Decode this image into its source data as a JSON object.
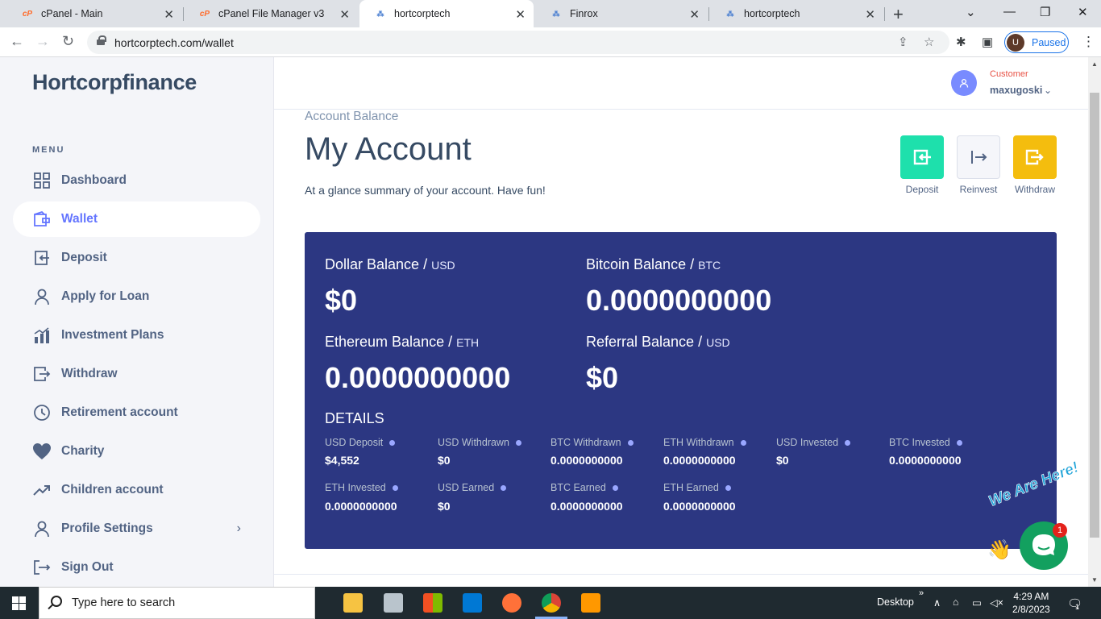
{
  "browser": {
    "tabs": [
      {
        "title": "cPanel - Main",
        "favicon": "cpanel-icon"
      },
      {
        "title": "cPanel File Manager v3",
        "favicon": "cpanel-icon"
      },
      {
        "title": "hortcorptech",
        "favicon": "site-icon",
        "active": true
      },
      {
        "title": "Finrox",
        "favicon": "site-icon"
      },
      {
        "title": "hortcorptech",
        "favicon": "site-icon"
      }
    ],
    "url": "hortcorptech.com/wallet",
    "profile_initial": "U",
    "profile_status": "Paused"
  },
  "sidebar": {
    "brand": "Hortcorpfinance",
    "menu_heading": "MENU",
    "items": [
      {
        "label": "Dashboard",
        "icon": "dashboard-icon"
      },
      {
        "label": "Wallet",
        "icon": "wallet-icon",
        "active": true
      },
      {
        "label": "Deposit",
        "icon": "deposit-icon"
      },
      {
        "label": "Apply for Loan",
        "icon": "user-icon"
      },
      {
        "label": "Investment Plans",
        "icon": "chart-icon"
      },
      {
        "label": "Withdraw",
        "icon": "withdraw-icon"
      },
      {
        "label": "Retirement account",
        "icon": "clock-icon"
      },
      {
        "label": "Charity",
        "icon": "heart-icon"
      },
      {
        "label": "Children account",
        "icon": "trend-icon"
      },
      {
        "label": "Profile Settings",
        "icon": "user-icon",
        "has_submenu": true
      },
      {
        "label": "Sign Out",
        "icon": "signout-icon"
      }
    ]
  },
  "header": {
    "user_role": "Customer",
    "user_name": "maxugoski"
  },
  "main": {
    "subtitle": "Account Balance",
    "title": "My Account",
    "lead": "At a glance summary of your account. Have fun!",
    "actions": [
      {
        "label": "Deposit",
        "color": "#1ee0ac"
      },
      {
        "label": "Reinvest",
        "color": "#f5f6fa"
      },
      {
        "label": "Withdraw",
        "color": "#f4bd0e"
      }
    ],
    "balances": [
      {
        "label": "Dollar Balance",
        "unit": "USD",
        "value": "$0"
      },
      {
        "label": "Bitcoin Balance",
        "unit": "BTC",
        "value": "0.0000000000"
      },
      {
        "label": "Ethereum Balance",
        "unit": "ETH",
        "value": "0.0000000000"
      },
      {
        "label": "Referral Balance",
        "unit": "USD",
        "value": "$0"
      }
    ],
    "details_heading": "DETAILS",
    "details": [
      {
        "label": "USD Deposit",
        "value": "$4,552"
      },
      {
        "label": "USD Withdrawn",
        "value": "$0"
      },
      {
        "label": "BTC Withdrawn",
        "value": "0.0000000000"
      },
      {
        "label": "ETH Withdrawn",
        "value": "0.0000000000"
      },
      {
        "label": "USD Invested",
        "value": "$0"
      },
      {
        "label": "BTC Invested",
        "value": "0.0000000000"
      },
      {
        "label": "ETH Invested",
        "value": "0.0000000000"
      },
      {
        "label": "USD Earned",
        "value": "$0"
      },
      {
        "label": "BTC Earned",
        "value": "0.0000000000"
      },
      {
        "label": "ETH Earned",
        "value": "0.0000000000"
      }
    ],
    "card_color": "#2c3782"
  },
  "chat_widget": {
    "banner": "We Are Here!",
    "badge_count": "1"
  },
  "taskbar": {
    "search_placeholder": "Type here to search",
    "desktop_label": "Desktop",
    "time": "4:29 AM",
    "date": "2/8/2023",
    "notification_count": "1"
  }
}
